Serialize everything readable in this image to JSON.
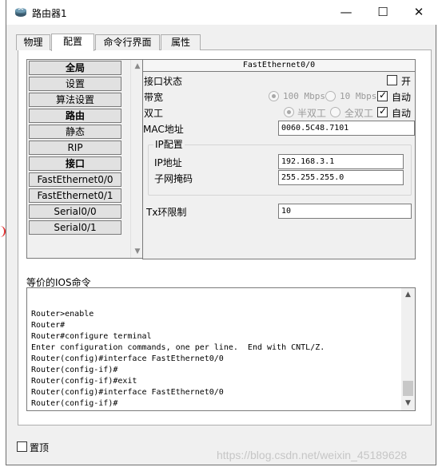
{
  "window": {
    "title": "路由器1",
    "controls": {
      "minimize": "—",
      "maximize": "☐",
      "close": "✕"
    }
  },
  "tabs": [
    {
      "label": "物理"
    },
    {
      "label": "配置",
      "active": true
    },
    {
      "label": "命令行界面"
    },
    {
      "label": "属性"
    }
  ],
  "sidebar": {
    "items": [
      {
        "label": "全局",
        "bold": true
      },
      {
        "label": "设置"
      },
      {
        "label": "算法设置"
      },
      {
        "label": "路由",
        "bold": true
      },
      {
        "label": "静态"
      },
      {
        "label": "RIP"
      },
      {
        "label": "接口",
        "bold": true
      },
      {
        "label": "FastEthernet0/0"
      },
      {
        "label": "FastEthernet0/1"
      },
      {
        "label": "Serial0/0"
      },
      {
        "label": "Serial0/1"
      }
    ]
  },
  "interface": {
    "title": "FastEthernet0/0",
    "port_status_label": "接口状态",
    "port_status_on_label": "开",
    "port_status_on": false,
    "bandwidth_label": "带宽",
    "bandwidth_100": "100 Mbps",
    "bandwidth_10": "10 Mbps",
    "bandwidth_auto_label": "自动",
    "bandwidth_auto": true,
    "duplex_label": "双工",
    "duplex_half": "半双工",
    "duplex_full": "全双工",
    "duplex_auto_label": "自动",
    "duplex_auto": true,
    "mac_label": "MAC地址",
    "mac_value": "0060.5C48.7101",
    "ip_group_label": "IP配置",
    "ip_label": "IP地址",
    "ip_value": "192.168.3.1",
    "mask_label": "子网掩码",
    "mask_value": "255.255.255.0",
    "tx_label": "Tx环限制",
    "tx_value": "10"
  },
  "console": {
    "label": "等价的IOS命令",
    "lines": [
      "Router>enable",
      "Router#",
      "Router#configure terminal",
      "Enter configuration commands, one per line.  End with CNTL/Z.",
      "Router(config)#interface FastEthernet0/0",
      "Router(config-if)#",
      "Router(config-if)#exit",
      "Router(config)#interface FastEthernet0/0",
      "Router(config-if)#"
    ]
  },
  "footer": {
    "pin_label": "置顶",
    "pinned": false,
    "watermark": "https://blog.csdn.net/weixin_45189628"
  },
  "colors": {
    "window_bg": "#f0f0f0",
    "button_bg": "#e1e1e1",
    "border": "#7a7a7a"
  }
}
